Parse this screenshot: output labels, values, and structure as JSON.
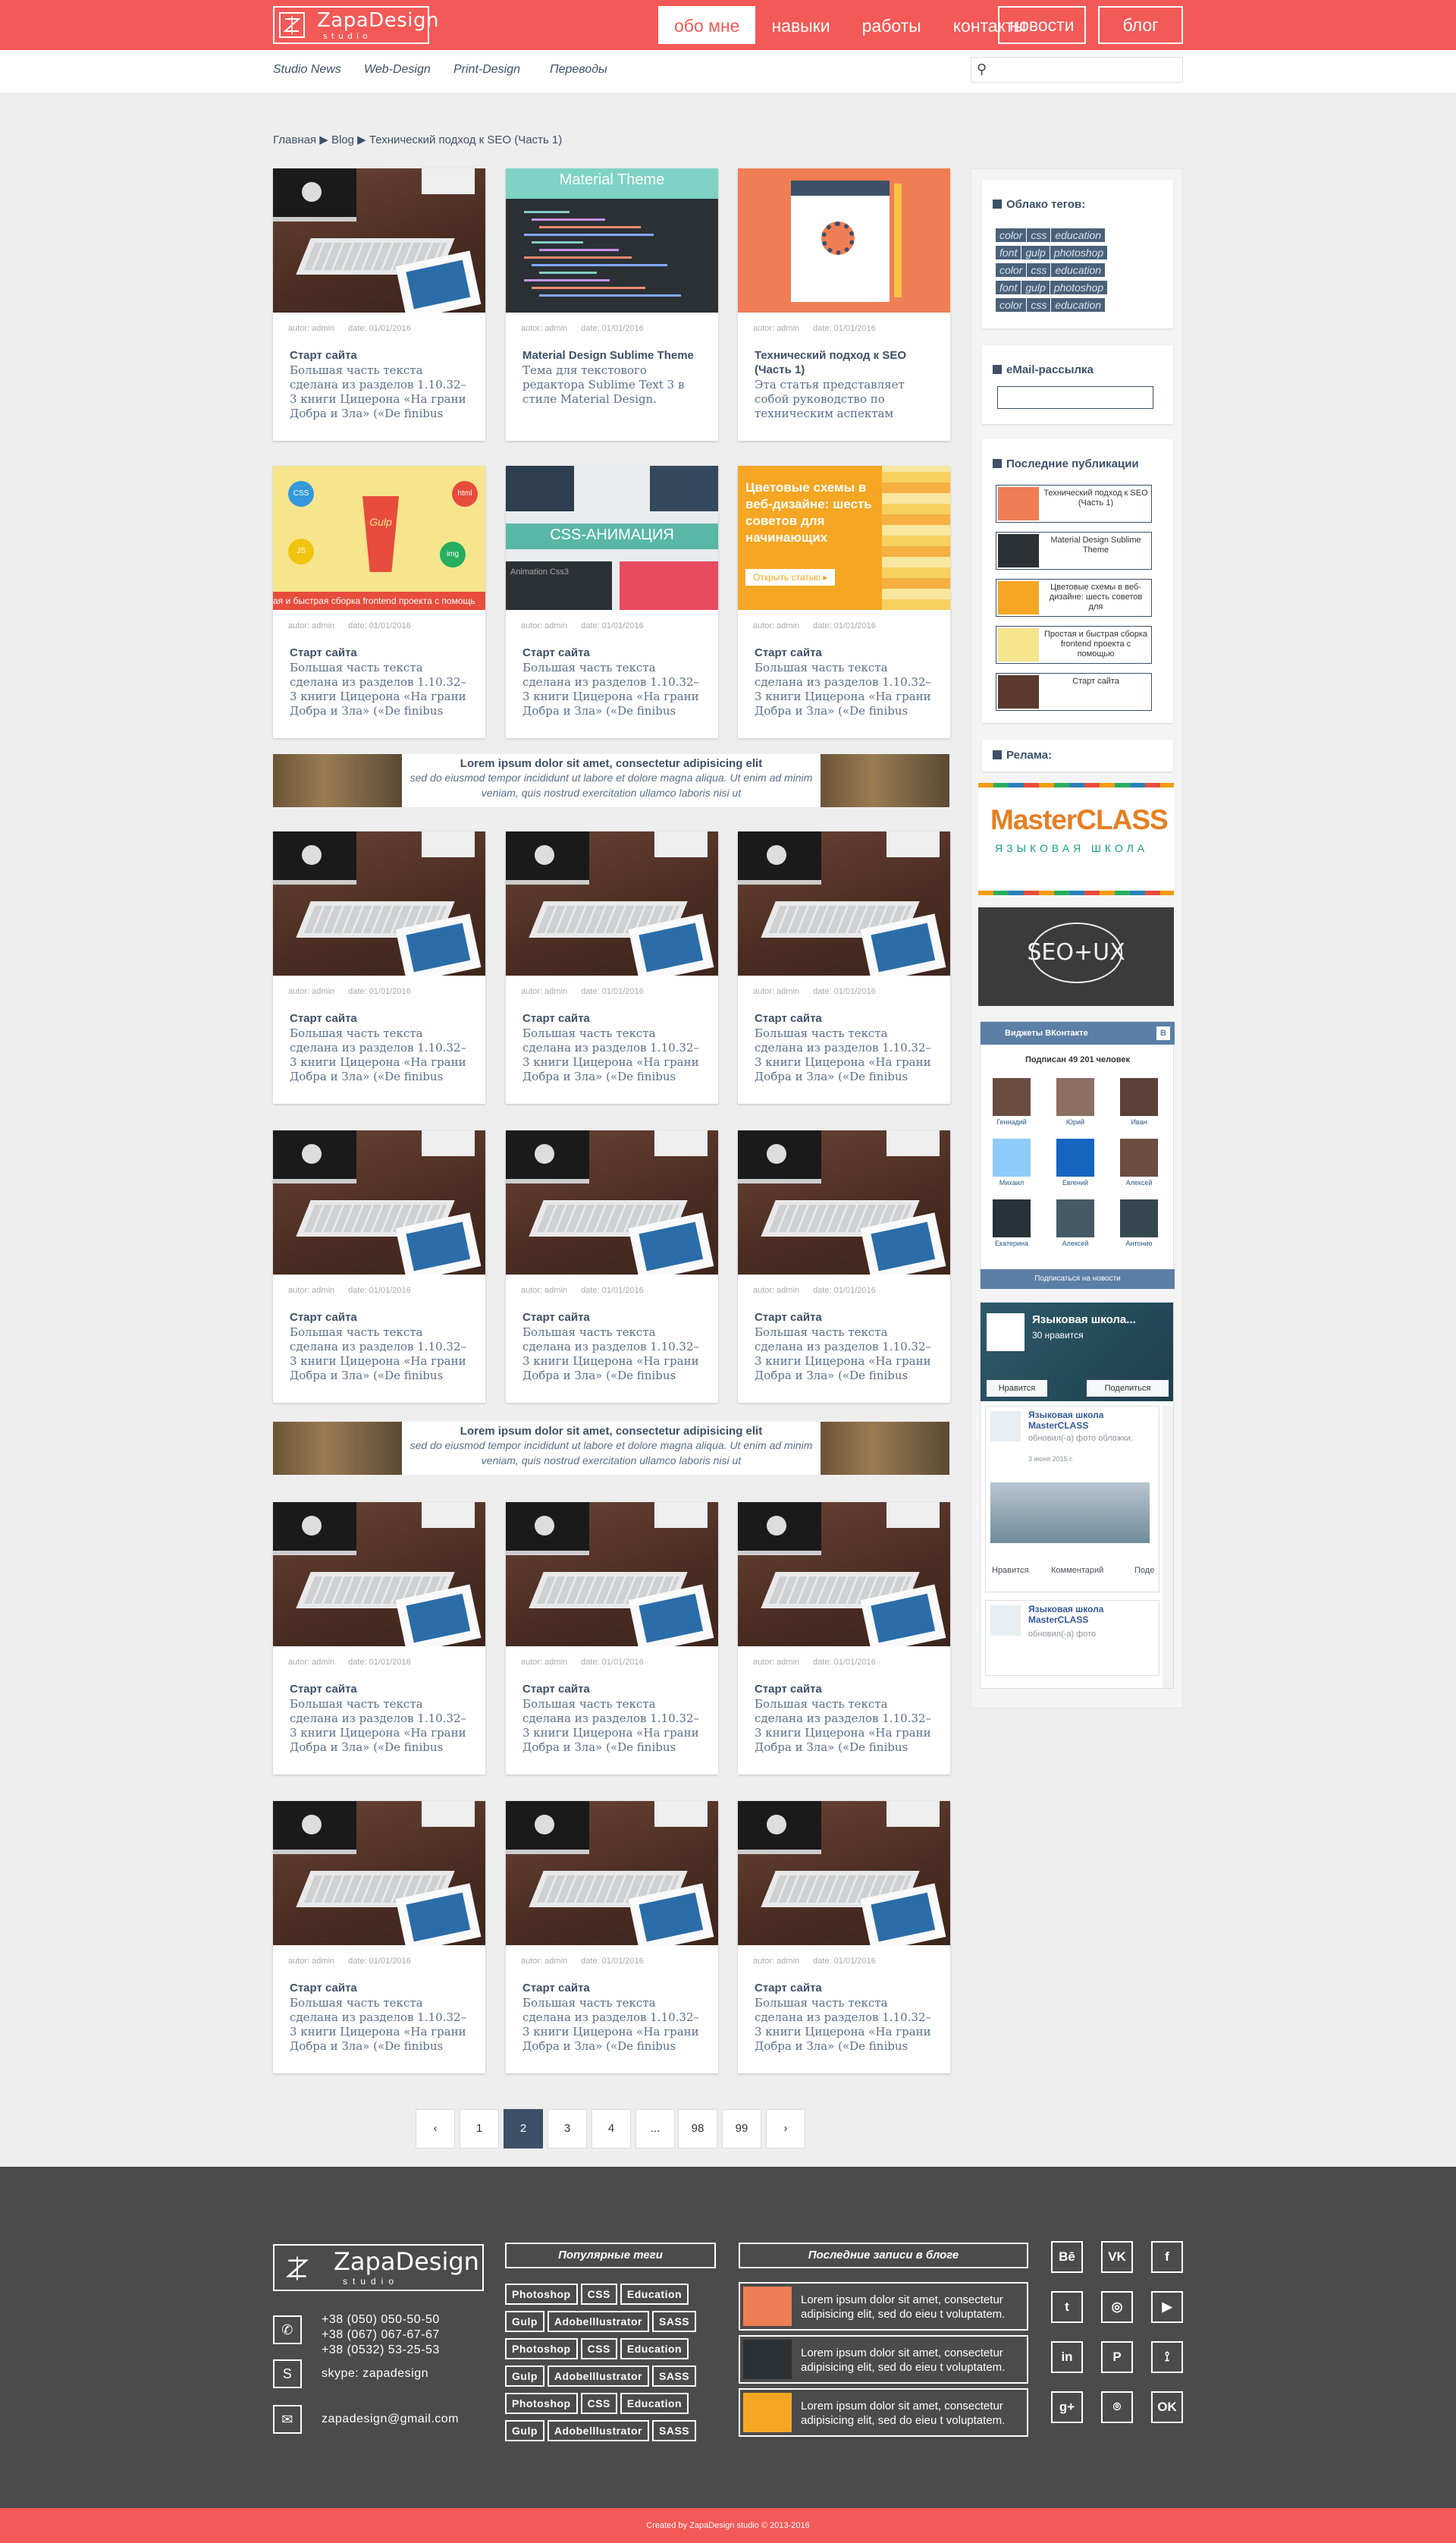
{
  "header": {
    "logo_name": "ZapaDesign",
    "logo_sub": "studio",
    "nav": [
      "обо мне",
      "навыки",
      "работы",
      "контакты"
    ],
    "nav_active": 0,
    "news": "новости",
    "blog": "блог",
    "accent_color": "#f35956",
    "text_color": "#3e5068"
  },
  "subnav": [
    "Studio News",
    "Web-Design",
    "Print-Design",
    "Переводы"
  ],
  "search": {
    "placeholder": "",
    "icon": "search-icon"
  },
  "breadcrumbs": [
    "Главная",
    "Blog",
    "Технический подход к SEO (Часть 1)"
  ],
  "cards": [
    {
      "author": "autor: admin",
      "date": "date: 01/01/2016",
      "title": "Старт сайта",
      "text": "Большая часть текста сделана из разделов 1.10.32–3 книги Цицерона «На грани Добра и Зла» («De finibus bonorum et"
    },
    {
      "author": "autor: admin",
      "date": "date: 01/01/2016",
      "title": "Material Design Sublime Theme",
      "text": "Тема для текстового редактора Sublime Text 3 в стиле Material Design."
    },
    {
      "author": "autor: admin",
      "date": "date: 01/01/2016",
      "title": "Технический подход к SEO (Часть 1)",
      "text": "Эта статья представляет собой руководство по техническим аспектам поискового"
    },
    {
      "author": "autor: admin",
      "date": "date: 01/01/2016",
      "title": "Старт сайта",
      "text": "Большая часть текста сделана из разделов 1.10.32–3 книги Цицерона «На грани Добра и Зла» («De finibus bonorum et"
    }
  ],
  "image_texts": {
    "material": "Material Theme",
    "gulp": "Gulp",
    "gulp_caption": "ая и быстрая сборка frontend проекта с помощь",
    "gulp_nodes": [
      "CSS",
      "html",
      "JS",
      "img"
    ],
    "css_anim": "CSS-АНИМАЦИЯ",
    "css_small": "Animation Css3",
    "color_title": "Цветовые схемы в веб-дизайне: шесть советов для начинающих",
    "color_btn": "Открыть статью ▸"
  },
  "banner": {
    "title": "Lorem ipsum dolor sit amet, consectetur adipisicing elit",
    "text": "sed do eiusmod tempor incididunt ut labore et dolore magna aliqua. Ut enim ad minim veniam, quis nostrud exercitation ullamco laboris nisi ut"
  },
  "sidebar": {
    "tags_title": "Облако тегов:",
    "tag_rows": [
      [
        "color",
        "css",
        "education"
      ],
      [
        "font",
        "gulp",
        "photoshop"
      ],
      [
        "color",
        "css",
        "education"
      ],
      [
        "font",
        "gulp",
        "photoshop"
      ],
      [
        "color",
        "css",
        "education"
      ]
    ],
    "email_title": "eMail-рассылка",
    "recent_title": "Последние публикации",
    "recent": [
      "Технический подход к SEO (Часть 1)",
      "Material Design Sublime Theme",
      "Цветовые схемы в веб-дизайне: шесть советов для",
      "Простая и быстрая сборка frontend проекта с помощью",
      "Старт сайта"
    ],
    "ads_title": "Релама:",
    "masterclass_name": "MasterCLASS",
    "masterclass_sub": "ЯЗЫКОВАЯ ШКОЛА",
    "seo_text": "SEO+UX",
    "vk": {
      "header": "Виджеты ВКонтакте",
      "subscribers": "Подписан 49 201 человек",
      "users": [
        "Геннадий",
        "Юрий",
        "Иван",
        "Михаил",
        "Евгений",
        "Алексей",
        "Екатерина",
        "Алексей",
        "Антонио"
      ],
      "button": "Подписаться на новости"
    },
    "fb": {
      "page": "Языковая школа...",
      "likes": "30 нравится",
      "like_btn": "Нравится",
      "share_btn": "Поделиться",
      "post_name": "Языковая школа MasterCLASS",
      "post_action": "обновил(-а) фото обложки.",
      "post_date": "3 июня 2015 г.",
      "actions": [
        "Нравится",
        "Комментарий",
        "Поде"
      ],
      "post2_name": "Языковая школа MasterCLASS",
      "post2_action": "обновил(-а) фото"
    }
  },
  "pagination": [
    "‹",
    "1",
    "2",
    "3",
    "4",
    "...",
    "98",
    "99",
    "›"
  ],
  "pagination_active": 2,
  "footer": {
    "logo_name": "ZapaDesign",
    "logo_sub": "studio",
    "phones": [
      "+38 (050) 050-50-50",
      "+38 (067) 067-67-67",
      "+38 (0532) 53-25-53"
    ],
    "skype": "skype: zapadesign",
    "email": "zapadesign@gmail.com",
    "tags_title": "Популярные теги",
    "tags": [
      "Photoshop",
      "CSS",
      "Education",
      "Gulp",
      "Adobelllustrator",
      "SASS",
      "Photoshop",
      "CSS",
      "Education",
      "Gulp",
      "Adobelllustrator",
      "SASS",
      "Photoshop",
      "CSS",
      "Education",
      "Gulp",
      "Adobelllustrator",
      "SASS"
    ],
    "posts_title": "Последние записи в блоге",
    "post_text": "Lorem ipsum dolor sit amet, consectetur adipisicing elit, sed do eieu  t voluptatem.",
    "social": [
      "Bē",
      "VK",
      "f",
      "t",
      "◎",
      "▶",
      "in",
      "P",
      "⟟",
      "g+",
      "⌾",
      "OK"
    ],
    "copyright": "Created by ZapaDesign studio © 2013-2016"
  }
}
